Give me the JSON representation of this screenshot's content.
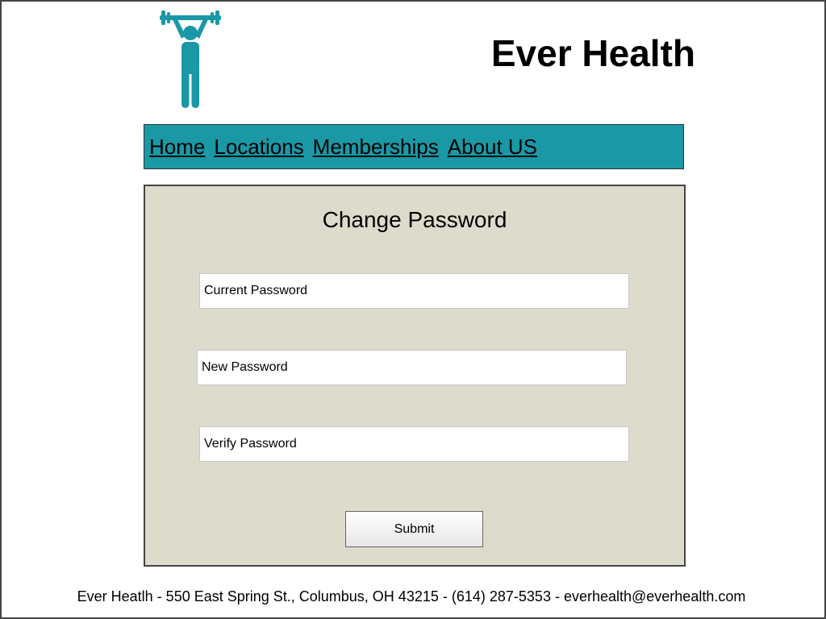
{
  "brand": {
    "title": "Ever Health",
    "logo_icon": "weightlifter-icon",
    "accent_color": "#1a98a6"
  },
  "nav": {
    "background_color": "#1a98a6",
    "items": [
      {
        "label": "Home"
      },
      {
        "label": "Locations"
      },
      {
        "label": "Memberships"
      },
      {
        "label": "About US"
      }
    ]
  },
  "form": {
    "background_color": "#dddbcc",
    "title": "Change Password",
    "fields": {
      "current": {
        "placeholder": "Current Password",
        "value": ""
      },
      "new": {
        "placeholder": "New Password",
        "value": ""
      },
      "verify": {
        "placeholder": "Verify Password",
        "value": ""
      }
    },
    "submit_label": "Submit"
  },
  "footer": {
    "text": "Ever Heatlh - 550 East Spring St., Columbus, OH 43215 - (614) 287-5353 - everhealth@everhealth.com"
  }
}
